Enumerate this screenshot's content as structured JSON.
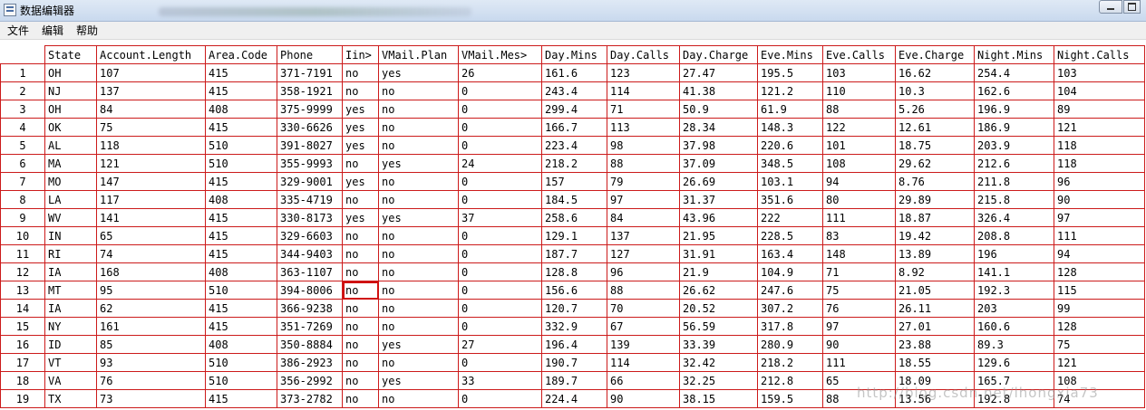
{
  "window": {
    "title": "数据编辑器",
    "colors": {
      "grid_border": "#cc1b1b",
      "titlebar": "#c9d9ee"
    }
  },
  "menubar": {
    "items": [
      "文件",
      "编辑",
      "帮助"
    ]
  },
  "grid": {
    "columns": [
      "State",
      "Account.Length",
      "Area.Code",
      "Phone",
      "Iin>",
      "VMail.Plan",
      "VMail.Mes>",
      "Day.Mins",
      "Day.Calls",
      "Day.Charge",
      "Eve.Mins",
      "Eve.Calls",
      "Eve.Charge",
      "Night.Mins",
      "Night.Calls"
    ],
    "rows": [
      {
        "num": "1",
        "cells": [
          "OH",
          "107",
          "415",
          "371-7191",
          "no",
          "yes",
          "26",
          "161.6",
          "123",
          "27.47",
          "195.5",
          "103",
          "16.62",
          "254.4",
          "103"
        ]
      },
      {
        "num": "2",
        "cells": [
          "NJ",
          "137",
          "415",
          "358-1921",
          "no",
          "no",
          "0",
          "243.4",
          "114",
          "41.38",
          "121.2",
          "110",
          "10.3",
          "162.6",
          "104"
        ]
      },
      {
        "num": "3",
        "cells": [
          "OH",
          "84",
          "408",
          "375-9999",
          "yes",
          "no",
          "0",
          "299.4",
          "71",
          "50.9",
          "61.9",
          "88",
          "5.26",
          "196.9",
          "89"
        ]
      },
      {
        "num": "4",
        "cells": [
          "OK",
          "75",
          "415",
          "330-6626",
          "yes",
          "no",
          "0",
          "166.7",
          "113",
          "28.34",
          "148.3",
          "122",
          "12.61",
          "186.9",
          "121"
        ]
      },
      {
        "num": "5",
        "cells": [
          "AL",
          "118",
          "510",
          "391-8027",
          "yes",
          "no",
          "0",
          "223.4",
          "98",
          "37.98",
          "220.6",
          "101",
          "18.75",
          "203.9",
          "118"
        ]
      },
      {
        "num": "6",
        "cells": [
          "MA",
          "121",
          "510",
          "355-9993",
          "no",
          "yes",
          "24",
          "218.2",
          "88",
          "37.09",
          "348.5",
          "108",
          "29.62",
          "212.6",
          "118"
        ]
      },
      {
        "num": "7",
        "cells": [
          "MO",
          "147",
          "415",
          "329-9001",
          "yes",
          "no",
          "0",
          "157",
          "79",
          "26.69",
          "103.1",
          "94",
          "8.76",
          "211.8",
          "96"
        ]
      },
      {
        "num": "8",
        "cells": [
          "LA",
          "117",
          "408",
          "335-4719",
          "no",
          "no",
          "0",
          "184.5",
          "97",
          "31.37",
          "351.6",
          "80",
          "29.89",
          "215.8",
          "90"
        ]
      },
      {
        "num": "9",
        "cells": [
          "WV",
          "141",
          "415",
          "330-8173",
          "yes",
          "yes",
          "37",
          "258.6",
          "84",
          "43.96",
          "222",
          "111",
          "18.87",
          "326.4",
          "97"
        ]
      },
      {
        "num": "10",
        "cells": [
          "IN",
          "65",
          "415",
          "329-6603",
          "no",
          "no",
          "0",
          "129.1",
          "137",
          "21.95",
          "228.5",
          "83",
          "19.42",
          "208.8",
          "111"
        ]
      },
      {
        "num": "11",
        "cells": [
          "RI",
          "74",
          "415",
          "344-9403",
          "no",
          "no",
          "0",
          "187.7",
          "127",
          "31.91",
          "163.4",
          "148",
          "13.89",
          "196",
          "94"
        ]
      },
      {
        "num": "12",
        "cells": [
          "IA",
          "168",
          "408",
          "363-1107",
          "no",
          "no",
          "0",
          "128.8",
          "96",
          "21.9",
          "104.9",
          "71",
          "8.92",
          "141.1",
          "128"
        ]
      },
      {
        "num": "13",
        "cells": [
          "MT",
          "95",
          "510",
          "394-8006",
          "no",
          "no",
          "0",
          "156.6",
          "88",
          "26.62",
          "247.6",
          "75",
          "21.05",
          "192.3",
          "115"
        ]
      },
      {
        "num": "14",
        "cells": [
          "IA",
          "62",
          "415",
          "366-9238",
          "no",
          "no",
          "0",
          "120.7",
          "70",
          "20.52",
          "307.2",
          "76",
          "26.11",
          "203",
          "99"
        ]
      },
      {
        "num": "15",
        "cells": [
          "NY",
          "161",
          "415",
          "351-7269",
          "no",
          "no",
          "0",
          "332.9",
          "67",
          "56.59",
          "317.8",
          "97",
          "27.01",
          "160.6",
          "128"
        ]
      },
      {
        "num": "16",
        "cells": [
          "ID",
          "85",
          "408",
          "350-8884",
          "no",
          "yes",
          "27",
          "196.4",
          "139",
          "33.39",
          "280.9",
          "90",
          "23.88",
          "89.3",
          "75"
        ]
      },
      {
        "num": "17",
        "cells": [
          "VT",
          "93",
          "510",
          "386-2923",
          "no",
          "no",
          "0",
          "190.7",
          "114",
          "32.42",
          "218.2",
          "111",
          "18.55",
          "129.6",
          "121"
        ]
      },
      {
        "num": "18",
        "cells": [
          "VA",
          "76",
          "510",
          "356-2992",
          "no",
          "yes",
          "33",
          "189.7",
          "66",
          "32.25",
          "212.8",
          "65",
          "18.09",
          "165.7",
          "108"
        ]
      },
      {
        "num": "19",
        "cells": [
          "TX",
          "73",
          "415",
          "373-2782",
          "no",
          "no",
          "0",
          "224.4",
          "90",
          "38.15",
          "159.5",
          "88",
          "13.56",
          "192.8",
          "74"
        ]
      }
    ]
  },
  "watermark": "http://blog.csdn.net/lhongxia73"
}
